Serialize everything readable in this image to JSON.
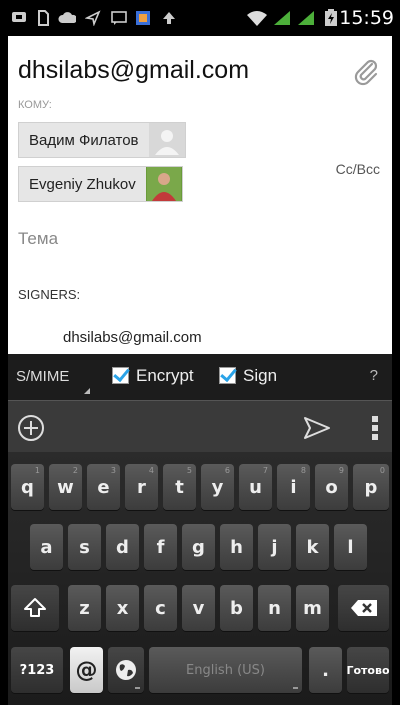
{
  "status_bar": {
    "time": "15:59",
    "icons": [
      "messaging-icon",
      "sim-icon",
      "cloud-icon",
      "send-icon",
      "sms-icon",
      "app-icon",
      "upload-icon",
      "wifi-icon",
      "signal-icon",
      "signal-icon",
      "battery-icon"
    ]
  },
  "compose": {
    "from": "dhsilabs@gmail.com",
    "to_label": "КОМУ:",
    "recipients": [
      "Вадим Филатов",
      "Evgeniy Zhukov"
    ],
    "cc_bcc": "Cc/Bcc",
    "subject_placeholder": "Тема",
    "signers_label": "SIGNERS:",
    "signer_email": "dhsilabs@gmail.com"
  },
  "smime": {
    "title": "S/MIME",
    "encrypt_label": "Encrypt",
    "encrypt_checked": true,
    "sign_label": "Sign",
    "sign_checked": true,
    "help": "?"
  },
  "keyboard": {
    "row1": [
      "q",
      "w",
      "e",
      "r",
      "t",
      "y",
      "u",
      "i",
      "o",
      "p"
    ],
    "row1_hints": [
      "1",
      "2",
      "3",
      "4",
      "5",
      "6",
      "7",
      "8",
      "9",
      "0"
    ],
    "row2": [
      "a",
      "s",
      "d",
      "f",
      "g",
      "h",
      "j",
      "k",
      "l"
    ],
    "row3": [
      "z",
      "x",
      "c",
      "v",
      "b",
      "n",
      "m"
    ],
    "symbols": "?123",
    "at": "@",
    "space": "English (US)",
    "period": ".",
    "done": "Готово"
  },
  "colors": {
    "check_accent": "#2aa3e8",
    "background": "#ffffff",
    "keyboard": "#1b1b1b"
  }
}
